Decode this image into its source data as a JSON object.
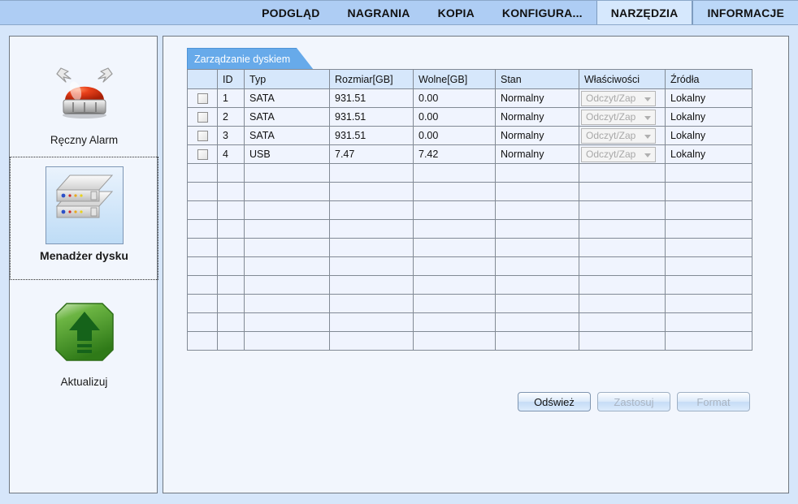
{
  "topnav": {
    "items": [
      {
        "label": "PODGLĄD",
        "state": "normal"
      },
      {
        "label": "NAGRANIA",
        "state": "normal"
      },
      {
        "label": "KOPIA",
        "state": "normal"
      },
      {
        "label": "KONFIGURA...",
        "state": "normal"
      },
      {
        "label": "NARZĘDZIA",
        "state": "active"
      },
      {
        "label": "INFORMACJE",
        "state": "tinted"
      }
    ]
  },
  "sidebar": {
    "items": [
      {
        "label": "Ręczny Alarm",
        "icon": "alarm-siren-icon",
        "selected": false
      },
      {
        "label": "Menadżer dysku",
        "icon": "disk-stack-icon",
        "selected": true
      },
      {
        "label": "Aktualizuj",
        "icon": "green-upload-arrow-icon",
        "selected": false
      }
    ]
  },
  "main": {
    "tab_label": "Zarządzanie dyskiem",
    "grid": {
      "columns": [
        "",
        "ID",
        "Typ",
        "Rozmiar[GB]",
        "Wolne[GB]",
        "Stan",
        "Właściwości",
        "Źródła"
      ],
      "rows": [
        {
          "checked": false,
          "id": "1",
          "typ": "SATA",
          "rozmiar": "931.51",
          "wolne": "0.00",
          "stan": "Normalny",
          "wlasciwosci": "Odczyt/Zap",
          "zrodla": "Lokalny"
        },
        {
          "checked": false,
          "id": "2",
          "typ": "SATA",
          "rozmiar": "931.51",
          "wolne": "0.00",
          "stan": "Normalny",
          "wlasciwosci": "Odczyt/Zap",
          "zrodla": "Lokalny"
        },
        {
          "checked": false,
          "id": "3",
          "typ": "SATA",
          "rozmiar": "931.51",
          "wolne": "0.00",
          "stan": "Normalny",
          "wlasciwosci": "Odczyt/Zap",
          "zrodla": "Lokalny"
        },
        {
          "checked": false,
          "id": "4",
          "typ": "USB",
          "rozmiar": "7.47",
          "wolne": "7.42",
          "stan": "Normalny",
          "wlasciwosci": "Odczyt/Zap",
          "zrodla": "Lokalny"
        }
      ],
      "empty_row_count": 10
    },
    "buttons": [
      {
        "label": "Odśwież",
        "enabled": true
      },
      {
        "label": "Zastosuj",
        "enabled": false
      },
      {
        "label": "Format",
        "enabled": false
      }
    ]
  },
  "colors": {
    "window_bg": "#d6e6fa",
    "topbar_bg": "#aecdf4",
    "panel_bg": "#f2f6fd",
    "tab_accent": "#67aaea",
    "header_row_bg": "#d6e7fb",
    "grid_bg": "#f0f4fe"
  }
}
